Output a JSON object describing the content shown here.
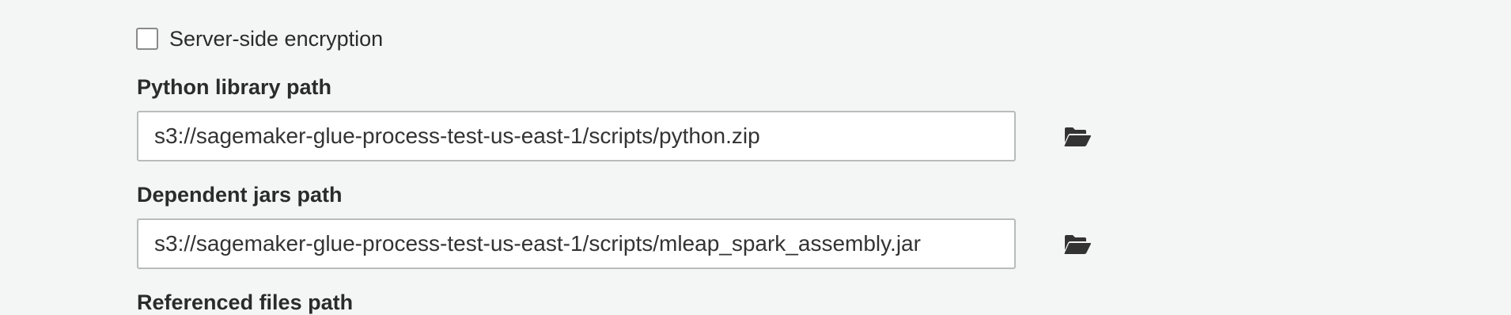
{
  "server_side_encryption": {
    "label": "Server-side encryption",
    "checked": false
  },
  "python_library_path": {
    "label": "Python library path",
    "value": "s3://sagemaker-glue-process-test-us-east-1/scripts/python.zip",
    "browse_icon": "folder-open-icon"
  },
  "dependent_jars_path": {
    "label": "Dependent jars path",
    "value": "s3://sagemaker-glue-process-test-us-east-1/scripts/mleap_spark_assembly.jar",
    "browse_icon": "folder-open-icon"
  },
  "referenced_files_path": {
    "label": "Referenced files path"
  },
  "colors": {
    "background": "#f4f5f5",
    "text": "#2b2b2b",
    "input_border": "#b9bcbc",
    "icon": "#333333"
  }
}
